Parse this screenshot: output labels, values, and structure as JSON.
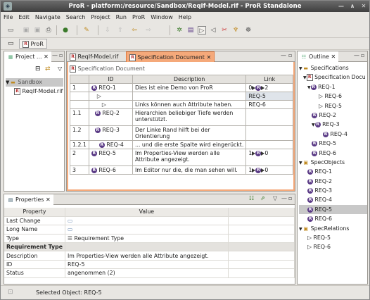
{
  "window": {
    "title": "ProR - platform:/resource/Sandbox/ReqIf-Model.rif - ProR Standalone"
  },
  "menu": [
    "File",
    "Edit",
    "Navigate",
    "Search",
    "Project",
    "Run",
    "ProR",
    "Window",
    "Help"
  ],
  "perspective": {
    "label": "ProR"
  },
  "project_explorer": {
    "tab": "Project ...",
    "tree": [
      {
        "label": "Sandbox",
        "selected": true
      },
      {
        "label": "ReqIf-Model.rif"
      }
    ]
  },
  "editor": {
    "tabs": [
      {
        "label": "ReqIf-Model.rif"
      },
      {
        "label": "Specification Document"
      }
    ],
    "header": "Specification Document",
    "columns": [
      "ID",
      "Description",
      "Link"
    ],
    "rows": [
      {
        "num": "1",
        "id": "REQ-1",
        "desc": "Dies ist eine Demo von ProR",
        "link": "0",
        "link2": "2"
      },
      {
        "num": "",
        "id": "",
        "desc": "",
        "link": "REQ-5"
      },
      {
        "num": "",
        "id": "",
        "desc": "Links können auch Attribute haben.",
        "link": "REQ-6"
      },
      {
        "num": "1.1",
        "id": "REQ-2",
        "desc": "Hierarchien beliebiger Tiefe werden unterstützt.",
        "link": ""
      },
      {
        "num": "1.2",
        "id": "REQ-3",
        "desc": "Der Linke Rand hilft bei der Orientierung",
        "link": ""
      },
      {
        "num": "1.2.1",
        "id": "REQ-4",
        "desc": "... und die erste Spalte wird eingerückt.",
        "link": ""
      },
      {
        "num": "2",
        "id": "REQ-5",
        "desc": "Im Properties-View werden alle Attribute angezeigt.",
        "link": "1",
        "link2": "0"
      },
      {
        "num": "3",
        "id": "REQ-6",
        "desc": "Im Editor nur die, die man sehen will.",
        "link": "1",
        "link2": "0"
      }
    ]
  },
  "outline": {
    "tab": "Outline",
    "items": [
      {
        "label": "Specifications"
      },
      {
        "label": "Specification Docu"
      },
      {
        "label": "REQ-1"
      },
      {
        "label": "REQ-6"
      },
      {
        "label": "REQ-5"
      },
      {
        "label": "REQ-2"
      },
      {
        "label": "REQ-3"
      },
      {
        "label": "REQ-4"
      },
      {
        "label": "REQ-5"
      },
      {
        "label": "REQ-6"
      },
      {
        "label": "SpecObjects"
      },
      {
        "label": "REQ-1"
      },
      {
        "label": "REQ-2"
      },
      {
        "label": "REQ-3"
      },
      {
        "label": "REQ-4"
      },
      {
        "label": "REQ-5"
      },
      {
        "label": "REQ-6"
      },
      {
        "label": "SpecRelations"
      },
      {
        "label": "REQ-5"
      },
      {
        "label": "REQ-6"
      }
    ]
  },
  "properties": {
    "tab": "Properties",
    "columns": [
      "Property",
      "Value"
    ],
    "rows": [
      {
        "prop": "Last Change",
        "value": ""
      },
      {
        "prop": "Long Name",
        "value": ""
      },
      {
        "prop": "Type",
        "value": "Requirement Type"
      },
      {
        "prop": "Requirement Type",
        "value": "",
        "group": true
      },
      {
        "prop": "Description",
        "value": "Im Properties-View werden alle Attribute angezeigt."
      },
      {
        "prop": "ID",
        "value": "REQ-5"
      },
      {
        "prop": "Status",
        "value": "angenommen (2)"
      }
    ]
  },
  "status": {
    "text": "Selected Object: REQ-5"
  },
  "colors": {
    "accent": "#f5a97a",
    "req_badge": "#5b3b86",
    "selection": "#c8c8c8"
  }
}
